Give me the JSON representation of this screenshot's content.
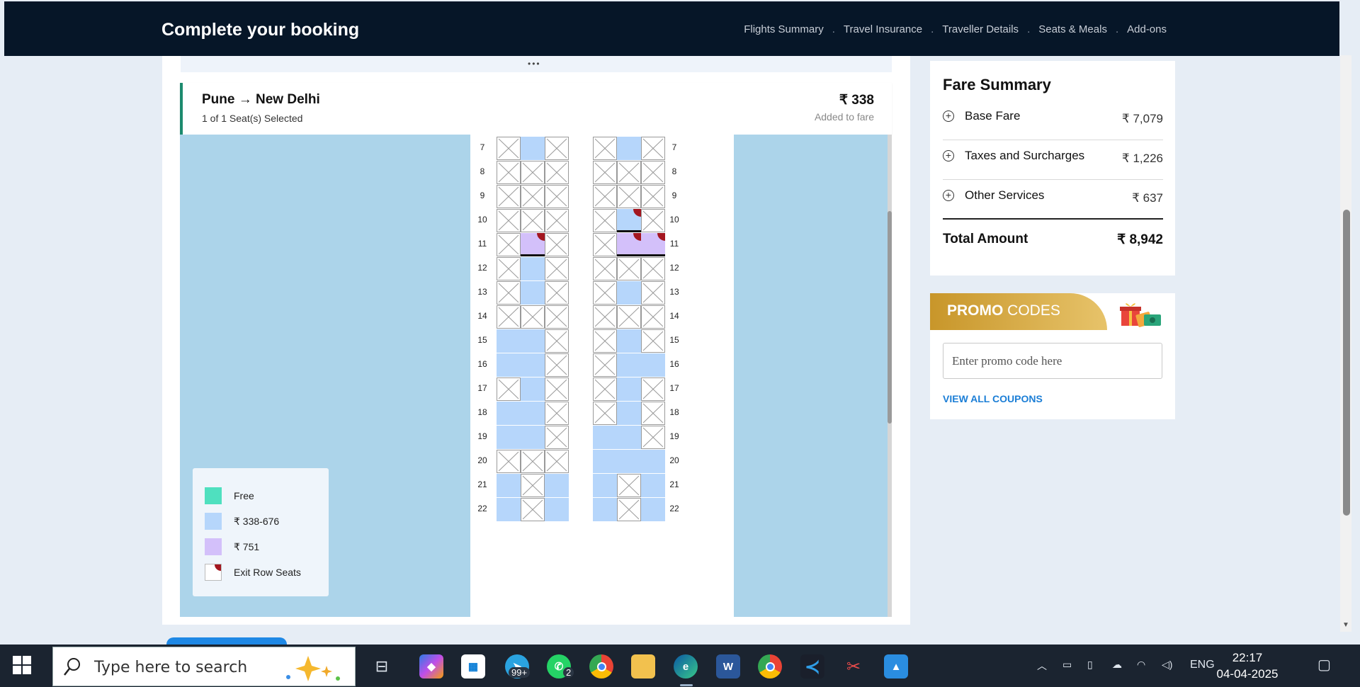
{
  "header": {
    "title": "Complete your booking",
    "steps": [
      "Flights Summary",
      "Travel Insurance",
      "Traveller Details",
      "Seats & Meals",
      "Add-ons"
    ]
  },
  "segment": {
    "dots": "•••",
    "route": "Pune → New Delhi",
    "selected": "1 of 1 Seat(s) Selected",
    "price": "₹ 338",
    "added": "Added to fare"
  },
  "seatmap": {
    "rows": [
      {
        "num": "7",
        "seats": [
          "x",
          "b",
          "x",
          "x",
          "b",
          "x"
        ]
      },
      {
        "num": "8",
        "seats": [
          "x",
          "x",
          "x",
          "x",
          "x",
          "x"
        ]
      },
      {
        "num": "9",
        "seats": [
          "x",
          "x",
          "x",
          "x",
          "x",
          "x"
        ]
      },
      {
        "num": "10",
        "seats": [
          "x",
          "x",
          "x",
          "x",
          "b-exit-sel",
          "x"
        ]
      },
      {
        "num": "11",
        "seats": [
          "x",
          "p-exit-sel",
          "x",
          "x",
          "p-exit-sel",
          "p-exit-sel"
        ]
      },
      {
        "num": "12",
        "seats": [
          "x",
          "b",
          "x",
          "x",
          "x",
          "x"
        ]
      },
      {
        "num": "13",
        "seats": [
          "x",
          "b",
          "x",
          "x",
          "b",
          "x"
        ]
      },
      {
        "num": "14",
        "seats": [
          "x",
          "x",
          "x",
          "x",
          "x",
          "x"
        ]
      },
      {
        "num": "15",
        "seats": [
          "b",
          "b",
          "x",
          "x",
          "b",
          "x"
        ]
      },
      {
        "num": "16",
        "seats": [
          "b",
          "b",
          "x",
          "x",
          "b",
          "b"
        ]
      },
      {
        "num": "17",
        "seats": [
          "x",
          "b",
          "x",
          "x",
          "b",
          "x"
        ]
      },
      {
        "num": "18",
        "seats": [
          "b",
          "b",
          "x",
          "x",
          "b",
          "x"
        ]
      },
      {
        "num": "19",
        "seats": [
          "b",
          "b",
          "x",
          "b",
          "b",
          "x"
        ]
      },
      {
        "num": "20",
        "seats": [
          "x",
          "x",
          "x",
          "b",
          "b",
          "b"
        ]
      },
      {
        "num": "21",
        "seats": [
          "b",
          "x",
          "b",
          "b",
          "x",
          "b"
        ]
      },
      {
        "num": "22",
        "seats": [
          "b",
          "x",
          "b",
          "b",
          "x",
          "b"
        ]
      }
    ]
  },
  "legend": {
    "free": "Free",
    "range": "₹ 338-676",
    "premium": "₹ 751",
    "exit": "Exit Row Seats",
    "colors": {
      "free": "#4fe0bf",
      "range": "#b6d6fb",
      "premium": "#d3c0fa",
      "exit_flag": "#a3161f"
    }
  },
  "fare": {
    "title": "Fare Summary",
    "base_label": "Base Fare",
    "base_amount": "₹ 7,079",
    "tax_label": "Taxes and Surcharges",
    "tax_amount": "₹ 1,226",
    "other_label": "Other Services",
    "other_amount": "₹ 637",
    "total_label": "Total Amount",
    "total_amount": "₹ 8,942"
  },
  "promo": {
    "banner_bold": "PROMO",
    "banner_rest": " CODES",
    "placeholder": "Enter promo code here",
    "view_all": "VIEW ALL COUPONS"
  },
  "taskbar": {
    "search_placeholder": "Type here to search",
    "telegram_badge": "99+",
    "whatsapp_badge": "2",
    "lang": "ENG",
    "time": "22:17",
    "date": "04-04-2025"
  }
}
